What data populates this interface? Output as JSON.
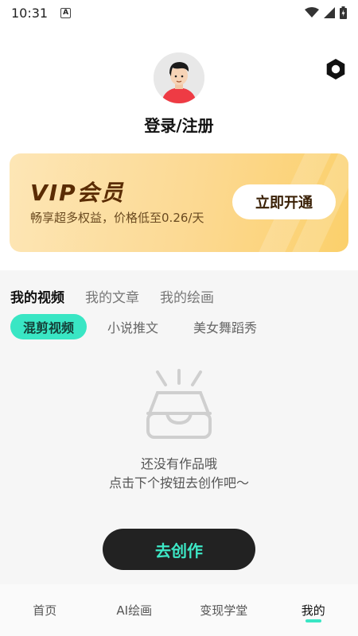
{
  "status_bar": {
    "time": "10:31",
    "notification_glyph": "A",
    "icons": [
      "wifi-icon",
      "signal-icon",
      "battery-icon"
    ]
  },
  "profile": {
    "login_label": "登录/注册",
    "avatar_icon": "user-avatar",
    "settings_icon": "hexagon-settings-icon"
  },
  "vip": {
    "title": "VIP会员",
    "subtitle": "畅享超多权益，价格低至0.26/天",
    "button_label": "立即开通"
  },
  "tabs": [
    {
      "label": "我的视频",
      "active": true
    },
    {
      "label": "我的文章",
      "active": false
    },
    {
      "label": "我的绘画",
      "active": false
    }
  ],
  "chips": [
    {
      "label": "混剪视频",
      "active": true
    },
    {
      "label": "小说推文",
      "active": false
    },
    {
      "label": "美女舞蹈秀",
      "active": false
    }
  ],
  "empty_state": {
    "icon": "empty-box-icon",
    "line1": "还没有作品哦",
    "line2": "点击下个按钮去创作吧～",
    "button_label": "去创作"
  },
  "bottom_nav": [
    {
      "label": "首页",
      "active": false
    },
    {
      "label": "AI绘画",
      "active": false
    },
    {
      "label": "变现学堂",
      "active": false
    },
    {
      "label": "我的",
      "active": true
    }
  ],
  "colors": {
    "accent": "#39e6c4",
    "vip_gradient_start": "#fde6b6",
    "vip_gradient_end": "#fbd06b",
    "dark_button": "#222222"
  }
}
